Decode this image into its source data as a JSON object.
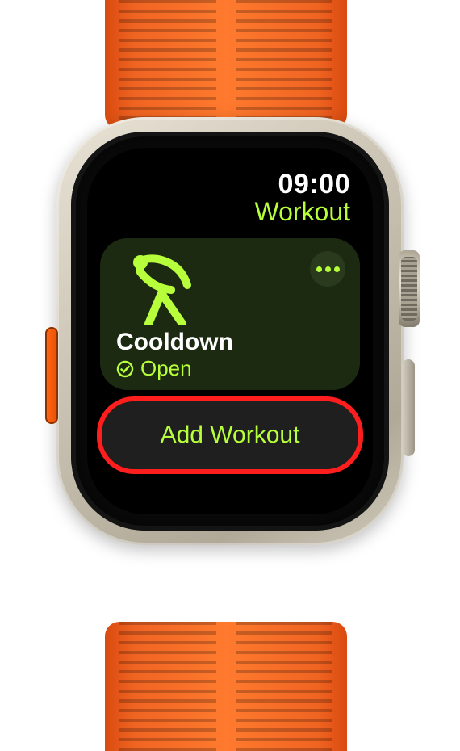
{
  "colors": {
    "accent": "#b7ff3b",
    "highlight": "#ff1e1e"
  },
  "status": {
    "time": "09:00",
    "app_title": "Workout"
  },
  "workout_card": {
    "icon": "cooldown-stretch-icon",
    "name": "Cooldown",
    "goal_label": "Open",
    "goal_icon": "checkmark-circle-icon",
    "more_icon": "more-ellipsis-icon"
  },
  "add_workout": {
    "label": "Add Workout"
  },
  "annotation": {
    "highlighted_target": "add-workout-button"
  }
}
